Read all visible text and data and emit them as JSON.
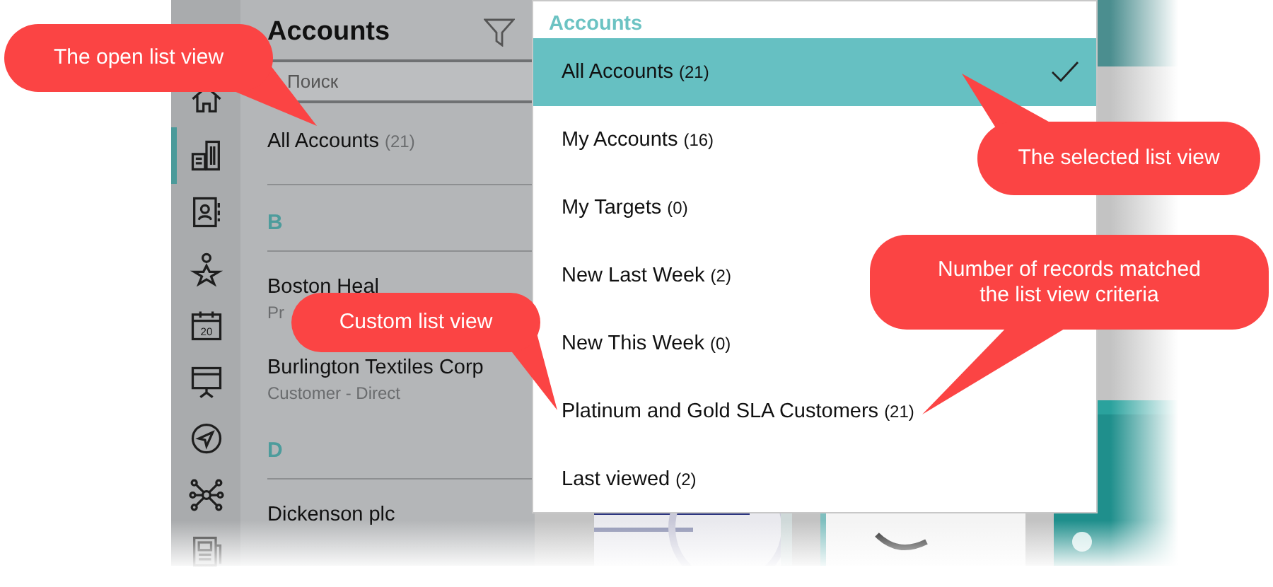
{
  "nav": [
    {
      "kind": "home",
      "selected": false
    },
    {
      "kind": "buildings",
      "selected": true
    },
    {
      "kind": "contacts",
      "selected": false
    },
    {
      "kind": "person-star",
      "selected": false
    },
    {
      "kind": "calendar",
      "label": "20",
      "selected": false
    },
    {
      "kind": "presentation",
      "selected": false
    },
    {
      "kind": "navigation",
      "selected": false
    },
    {
      "kind": "network",
      "selected": false
    },
    {
      "kind": "news",
      "selected": false
    }
  ],
  "list_panel": {
    "title": "Accounts",
    "search": {
      "placeholder": "Поиск"
    },
    "current_view": {
      "name": "All Accounts",
      "count": "(21)"
    },
    "rows": [
      {
        "kind": "header",
        "letter": "B"
      },
      {
        "kind": "record",
        "name": "Boston Heal",
        "subtitle": "Pr"
      },
      {
        "kind": "record",
        "name": "Burlington Textiles Corp",
        "subtitle": "Customer - Direct"
      },
      {
        "kind": "header",
        "letter": "D"
      },
      {
        "kind": "record",
        "name": "Dickenson plc"
      }
    ]
  },
  "view_menu": {
    "title": "Accounts",
    "items": [
      {
        "name": "All Accounts",
        "count": "(21)",
        "selected": true
      },
      {
        "name": "My Accounts",
        "count": "(16)",
        "selected": false
      },
      {
        "name": "My Targets",
        "count": "(0)",
        "selected": false
      },
      {
        "name": "New Last Week",
        "count": "(2)",
        "selected": false
      },
      {
        "name": "New This Week",
        "count": "(0)",
        "selected": false
      },
      {
        "name": "Platinum and Gold SLA Customers",
        "count": "(21)",
        "selected": false
      },
      {
        "name": "Last viewed",
        "count": "(2)",
        "selected": false
      }
    ]
  },
  "callouts": [
    {
      "text": "The open list view"
    },
    {
      "text": "The selected list view"
    },
    {
      "text": "Number of records matched the list view criteria"
    },
    {
      "text": "Custom list view"
    }
  ]
}
